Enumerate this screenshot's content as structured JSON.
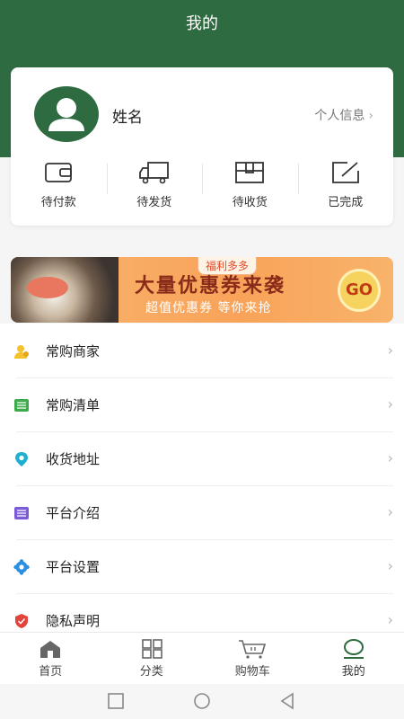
{
  "header": {
    "title": "我的"
  },
  "profile": {
    "name": "姓名",
    "info_link": "个人信息",
    "avatar_icon": "person-icon"
  },
  "orders": [
    {
      "label": "待付款",
      "icon": "wallet-icon"
    },
    {
      "label": "待发货",
      "icon": "truck-icon"
    },
    {
      "label": "待收货",
      "icon": "box-icon"
    },
    {
      "label": "已完成",
      "icon": "edit-icon"
    }
  ],
  "banner": {
    "tag": "福利多多",
    "headline": "大量优惠券来袭",
    "subline": "超值优惠券 等你来抢",
    "go": "GO"
  },
  "menu": [
    {
      "label": "常购商家",
      "icon": "person-icon",
      "color": "#f5c12e"
    },
    {
      "label": "常购清单",
      "icon": "list-icon",
      "color": "#3dab4b"
    },
    {
      "label": "收货地址",
      "icon": "location-pin-icon",
      "color": "#1fb0cf"
    },
    {
      "label": "平台介绍",
      "icon": "list-icon",
      "color": "#7b5cd6"
    },
    {
      "label": "平台设置",
      "icon": "settings-icon",
      "color": "#2b8fe0"
    },
    {
      "label": "隐私声明",
      "icon": "shield-icon",
      "color": "#e2433b"
    }
  ],
  "tabbar": [
    {
      "label": "首页",
      "icon": "home-icon"
    },
    {
      "label": "分类",
      "icon": "grid-icon"
    },
    {
      "label": "购物车",
      "icon": "cart-icon"
    },
    {
      "label": "我的",
      "icon": "profile-icon",
      "active": true
    }
  ],
  "colors": {
    "brand_green": "#2e6b40"
  }
}
